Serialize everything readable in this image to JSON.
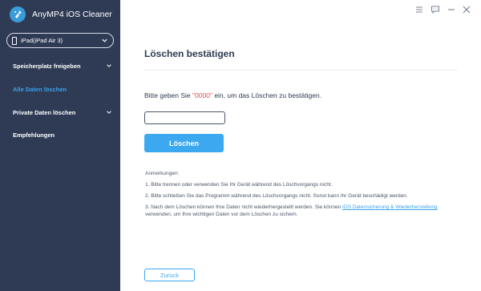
{
  "app": {
    "title": "AnyMP4 iOS Cleaner",
    "logo_icon": "broom-logo-icon",
    "accent_color": "#3ba8f0",
    "sidebar_color": "#2f3b55"
  },
  "device": {
    "label": "iPad(iPad Air 3)",
    "icon": "tablet-icon"
  },
  "sidebar": {
    "items": [
      {
        "label": "Speicherplatz freigeben",
        "has_chevron": true,
        "active": false
      },
      {
        "label": "Alle Daten löschen",
        "has_chevron": false,
        "active": true
      },
      {
        "label": "Private Daten löschen",
        "has_chevron": true,
        "active": false
      },
      {
        "label": "Empfehlungen",
        "has_chevron": false,
        "active": false
      }
    ]
  },
  "window_controls": [
    "menu-icon",
    "feedback-icon",
    "minimize-icon",
    "close-icon"
  ],
  "main": {
    "title": "Löschen bestätigen",
    "prompt_before": "Bitte geben Sie ",
    "prompt_code": "\"0000\"",
    "prompt_after": " ein, um das Löschen zu bestätigen.",
    "input_value": "",
    "delete_label": "Löschen",
    "notes_header": "Anmerkungen:",
    "note1": "1. Bitte trennen oder verwenden Sie Ihr Gerät während des Löschvorgangs nicht.",
    "note2": "2. Bitte schließen Sie das Programm während des Löschvorgangs nicht. Sonst kann Ihr Gerät beschädigt werden.",
    "note3_before": "3. Nach dem Löschen können Ihre Daten nicht wiederhergestellt werden. Sie können ",
    "note3_link": "iOS Datensicherung & Wiederherstellung",
    "note3_after": " verwenden, um Ihre wichtigen Daten vor dem Löschen zu sichern.",
    "back_label": "Zurück"
  }
}
